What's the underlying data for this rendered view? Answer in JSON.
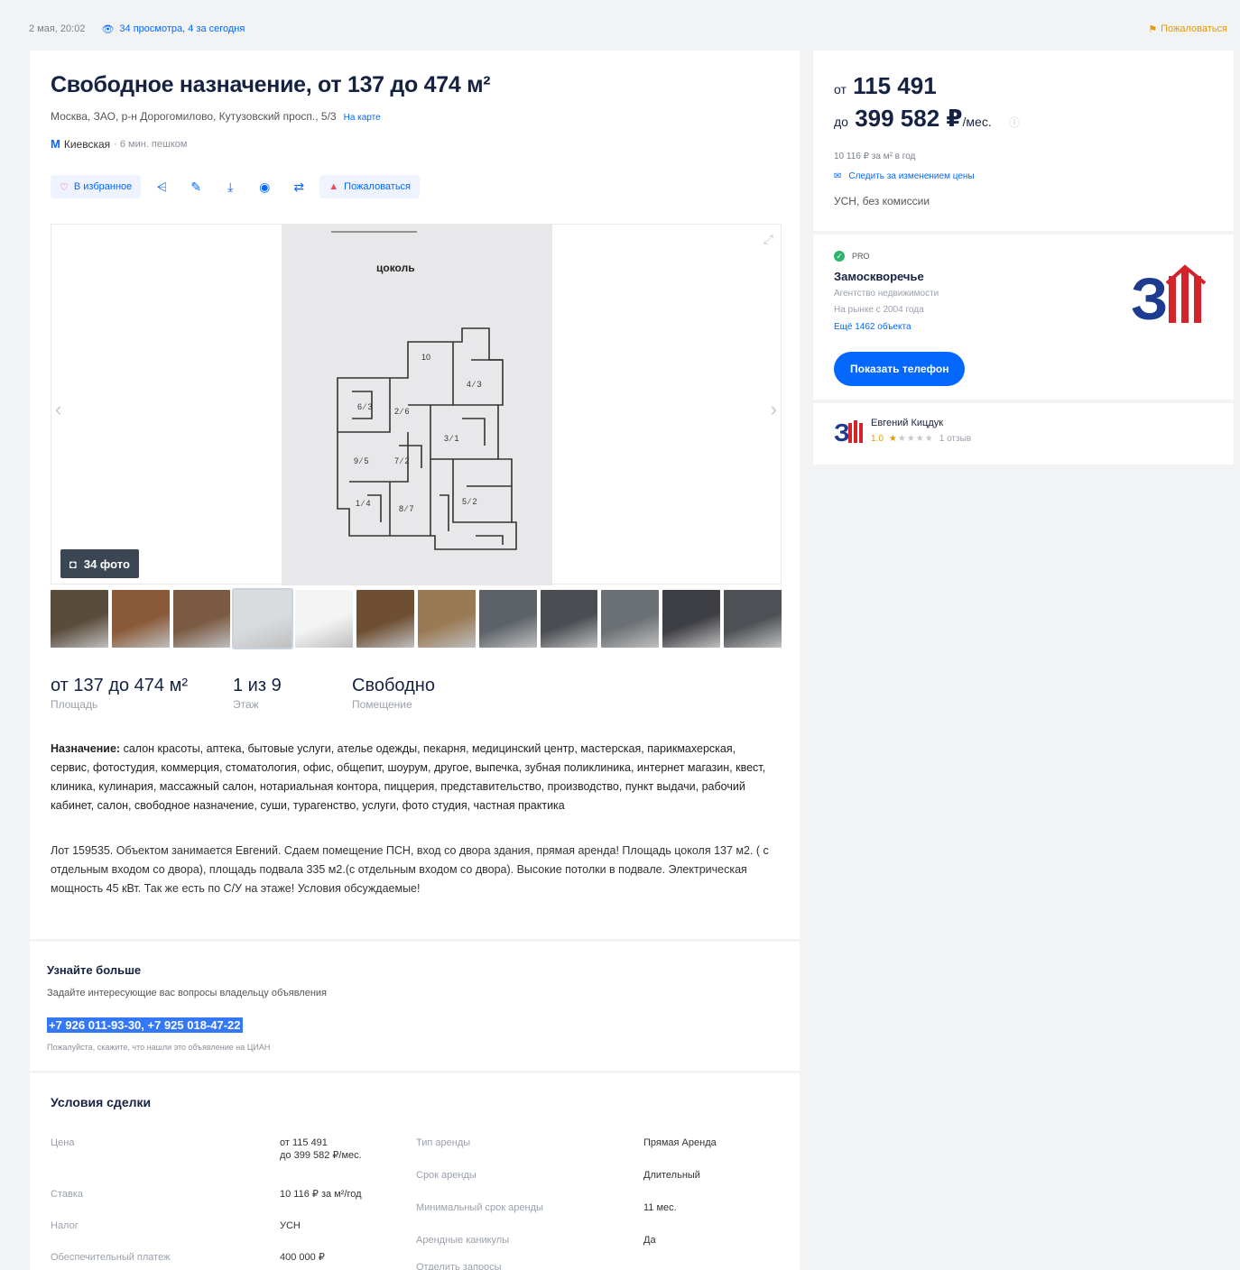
{
  "topbar": {
    "date": "2 мая, 20:02",
    "views": "34 просмотра, 4 за сегодня",
    "complain": "Пожаловаться"
  },
  "listing": {
    "title": "Свободное назначение, от 137 до 474 м²",
    "address": "Москва, ЗАО, р-н Дорогомилово, Кутузовский просп., 5/3",
    "map_link": "На карте",
    "metro_station": "Киевская",
    "metro_walk": "· 6 мин. пешком"
  },
  "actions": {
    "favorite": "В избранное",
    "complain": "Пожаловаться"
  },
  "gallery": {
    "photo_count": "34 фото",
    "plan_label": "цоколь",
    "thumb_colors": [
      "#5a4c3a",
      "#8a5a38",
      "#7a5a42",
      "#d9dcde",
      "#f4f4f4",
      "#6e4f33",
      "#9a7a55",
      "#5c6268",
      "#4a4d52",
      "#6b7074",
      "#3e3f44",
      "#4d5054"
    ]
  },
  "facts": [
    {
      "value": "от 137 до 474 м²",
      "label": "Площадь"
    },
    {
      "value": "1 из 9",
      "label": "Этаж"
    },
    {
      "value": "Свободно",
      "label": "Помещение"
    }
  ],
  "purpose": {
    "label": "Назначение:",
    "text": " салон красоты, аптека, бытовые услуги, ателье одежды, пекарня, медицинский центр, мастерская, парикмахерская, сервис, фотостудия, коммерция, стоматология, офис, общепит, шоурум, другое, выпечка, зубная поликлиника, интернет магазин, квест, клиника, кулинария, массажный салон, нотариальная контора, пиццерия, представительство, производство, пункт выдачи, рабочий кабинет, салон, свободное назначение, суши, турагенство, услуги, фото студия, частная практика"
  },
  "description": "Лот 159535. Объектом занимается Евгений. Сдаем помещение ПСН, вход со двора здания, прямая аренда! Площадь цоколя 137 м2. ( с отдельным входом со двора), площадь подвала 335 м2.(с отдельным входом со двора). Высокие потолки в подвале. Электрическая мощность 45 кВт. Так же есть по С/У на этаже! Условия обсуждаемые!",
  "learn": {
    "heading": "Узнайте больше",
    "subheading": "Задайте интересующие вас вопросы владельцу объявления",
    "phones": "+7 926 011-93-30, +7 925 018-47-22",
    "note": "Пожалуйста, скажите, что нашли это объявление на ЦИАН"
  },
  "deal": {
    "heading": "Условия сделки",
    "left": [
      {
        "key": "Цена",
        "value_line1": "от 115 491",
        "value_line2": "до 399 582 ₽/мес."
      },
      {
        "key": "Ставка",
        "value_line1": "10 116 ₽ за м²/год",
        "value_line2": ""
      },
      {
        "key": "Налог",
        "value_line1": "УСН",
        "value_line2": ""
      },
      {
        "key": "Обеспечительный платеж",
        "value_line1": "400 000 ₽",
        "value_line2": ""
      }
    ],
    "right": [
      {
        "key": "Тип аренды",
        "value": "Прямая Аренда"
      },
      {
        "key": "Срок аренды",
        "value": "Длительный"
      },
      {
        "key": "Минимальный срок аренды",
        "value": "11 мес."
      },
      {
        "key": "Арендные каникулы",
        "value": "Да"
      },
      {
        "key": "Отделить запросы",
        "value": ""
      }
    ]
  },
  "price": {
    "from_prefix": "от",
    "from_value": "115 491",
    "to_prefix": "до",
    "to_value": "399 582 ₽",
    "unit": "/мес.",
    "rate": "10 116 ₽ за м² в год",
    "follow": "Следить за изменением цены",
    "tax": "УСН, без комиссии"
  },
  "agency": {
    "badge": "PRO",
    "name": "Замоскворечье",
    "type": "Агентство недвижимости",
    "since": "На рынке с 2004 года",
    "more": "Ещё 1462 объекта",
    "show_phone": "Показать телефон",
    "logo_text": "ЗМ"
  },
  "agent": {
    "name": "Евгений Кицдук",
    "score": "1.0",
    "reviews": "1 отзыв",
    "rating_stars": 1
  },
  "colors": {
    "accent": "#0468ff",
    "title": "#152242",
    "logo_red": "#d4232b",
    "logo_blue": "#1d3c8f"
  }
}
